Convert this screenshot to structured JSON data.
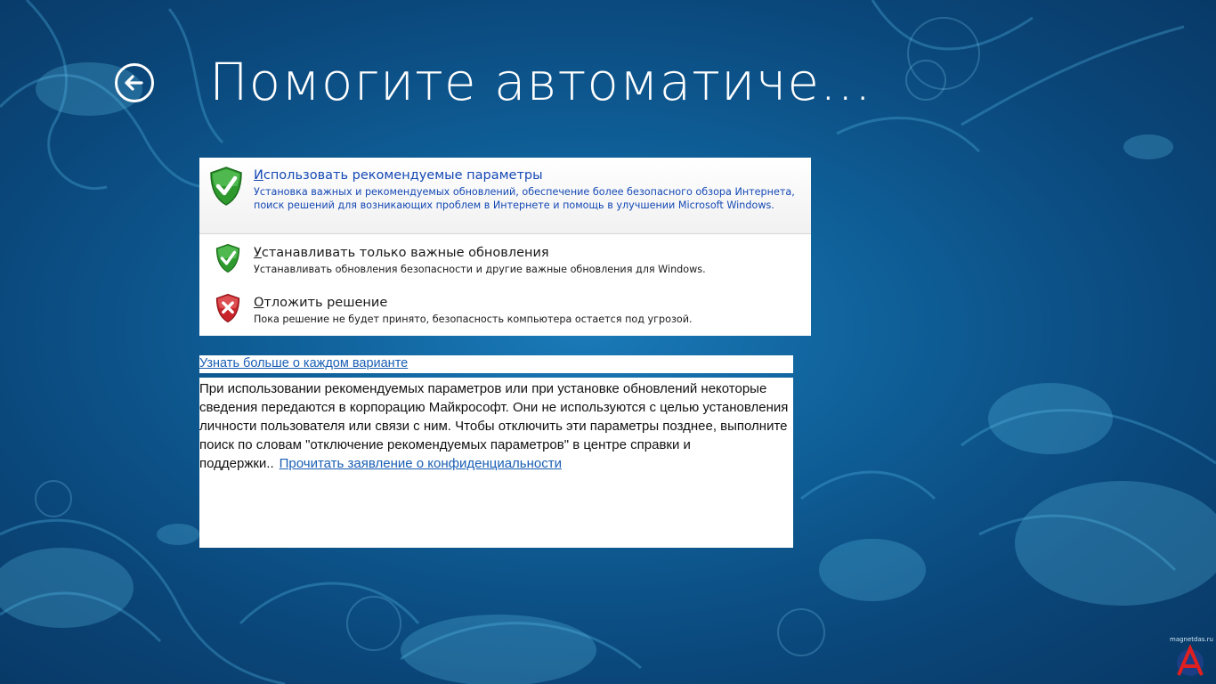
{
  "window": {
    "title": "Помогите автоматиче..."
  },
  "options": [
    {
      "title_first": "И",
      "title_rest": "спользовать рекомендуемые параметры",
      "description": "Установка важных и рекомендуемых обновлений, обеспечение более безопасного обзора Интернета, поиск решений для возникающих проблем в Интернете и помощь в улучшении Microsoft Windows.",
      "icon": "shield-green-check-icon"
    },
    {
      "title_first": "У",
      "title_rest": "станавливать только важные обновления",
      "description": "Устанавливать обновления безопасности и другие важные обновления для Windows.",
      "icon": "shield-green-check-icon"
    },
    {
      "title_first": "О",
      "title_rest": "тложить решение",
      "description": "Пока решение не будет принято, безопасность компьютера остается под угрозой.",
      "icon": "shield-red-x-icon"
    }
  ],
  "learn_more": "Узнать больше о каждом варианте",
  "info": {
    "text": "При использовании рекомендуемых параметров или при установке обновлений некоторые сведения передаются в корпорацию Майкрософт. Они не используются с целью установления личности пользователя или связи с ним. Чтобы отключить эти параметры позднее, выполните поиск по словам \"отключение рекомендуемых параметров\" в центре справки и поддержки..",
    "privacy_link": "Прочитать заявление о конфиденциальности"
  },
  "watermark": {
    "text": "magnetdas.ru"
  },
  "colors": {
    "background": "#0f5f98",
    "link": "#1a5fb4",
    "selected_option_text": "#1549b5",
    "shield_green": "#2e9a2e",
    "shield_red": "#c8242a"
  }
}
